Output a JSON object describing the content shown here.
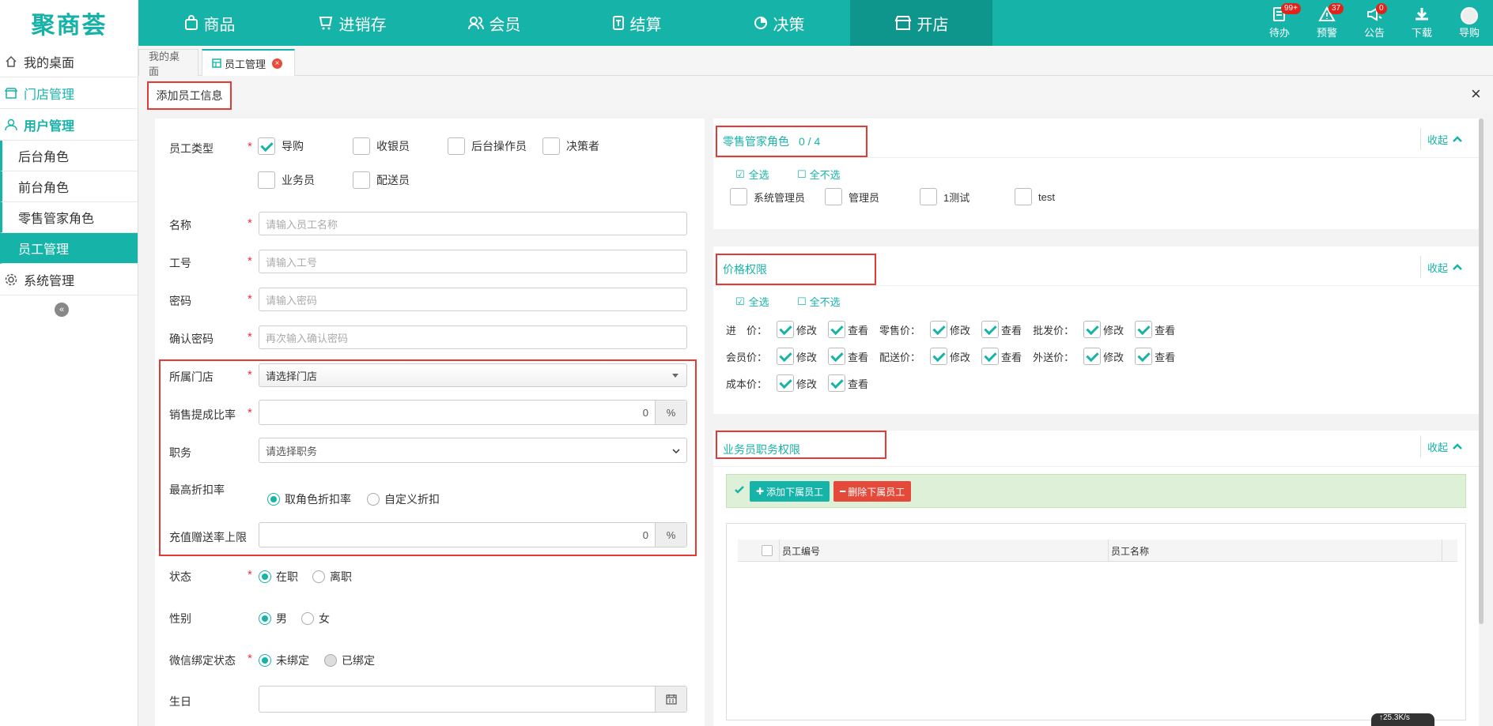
{
  "app": {
    "logo_text": "聚商荟",
    "brand_color": "#16b3a8",
    "accent_red": "#e53935"
  },
  "nav": [
    {
      "label": "商品",
      "icon": "bag-icon"
    },
    {
      "label": "进销存",
      "icon": "stock-icon"
    },
    {
      "label": "会员",
      "icon": "members-icon"
    },
    {
      "label": "结算",
      "icon": "settle-icon"
    },
    {
      "label": "决策",
      "icon": "decision-icon"
    },
    {
      "label": "开店",
      "icon": "store-icon",
      "active": true
    }
  ],
  "tools": {
    "todo": {
      "label": "待办",
      "badge": "99+"
    },
    "alert": {
      "label": "预警",
      "badge": "37"
    },
    "notice": {
      "label": "公告",
      "badge": "0"
    },
    "download": {
      "label": "下载"
    },
    "user": {
      "label": "导购"
    }
  },
  "sidebar": {
    "desk": "我的桌面",
    "store_mgmt": "门店管理",
    "user_mgmt": "用户管理",
    "sub": [
      "后台角色",
      "前台角色",
      "零售管家角色",
      "员工管理"
    ],
    "system": "系统管理"
  },
  "tabs": {
    "desk": "我的桌面",
    "staff": "员工管理"
  },
  "page": {
    "title": "添加员工信息",
    "close": "×"
  },
  "form": {
    "type_label": "员工类型",
    "types": {
      "guide": "导购",
      "cashier": "收银员",
      "backend": "后台操作员",
      "decider": "决策者",
      "sales": "业务员",
      "delivery": "配送员"
    },
    "name_label": "名称",
    "name_ph": "请输入员工名称",
    "no_label": "工号",
    "no_ph": "请输入工号",
    "pwd_label": "密码",
    "pwd_ph": "请输入密码",
    "pwd2_label": "确认密码",
    "pwd2_ph": "再次输入确认密码",
    "store_label": "所属门店",
    "store_value": "请选择门店",
    "commission_label": "销售提成比率",
    "commission_value": "0",
    "pct": "%",
    "job_label": "职务",
    "job_value": "请选择职务",
    "discount_label": "最高折扣率",
    "discount_opt1": "取角色折扣率",
    "discount_opt2": "自定义折扣",
    "recharge_label": "充值赠送率上限",
    "recharge_value": "0",
    "status_label": "状态",
    "status_on": "在职",
    "status_off": "离职",
    "gender_label": "性别",
    "gender_m": "男",
    "gender_f": "女",
    "wx_label": "微信绑定状态",
    "wx_unbound": "未绑定",
    "wx_bound": "已绑定",
    "birth_label": "生日",
    "req": "*"
  },
  "retail": {
    "title": "零售管家角色",
    "count": "0 / 4",
    "collapse": "收起",
    "select_all": "全选",
    "select_none": "全不选",
    "roles": [
      "系统管理员",
      "管理员",
      "1测试",
      "test"
    ]
  },
  "price": {
    "title": "价格权限",
    "collapse": "收起",
    "select_all": "全选",
    "select_none": "全不选",
    "edit": "修改",
    "view": "查看",
    "rows": [
      [
        "进　价：",
        "零售价：",
        "批发价："
      ],
      [
        "会员价：",
        "配送价：",
        "外送价："
      ],
      [
        "成本价："
      ]
    ]
  },
  "sales_perm": {
    "title": "业务员职务权限",
    "collapse": "收起",
    "add_btn": "添加下属员工",
    "del_btn": "删除下属员工",
    "col_no": "员工编号",
    "col_name": "员工名称"
  },
  "speed": "↑25.3K/s"
}
